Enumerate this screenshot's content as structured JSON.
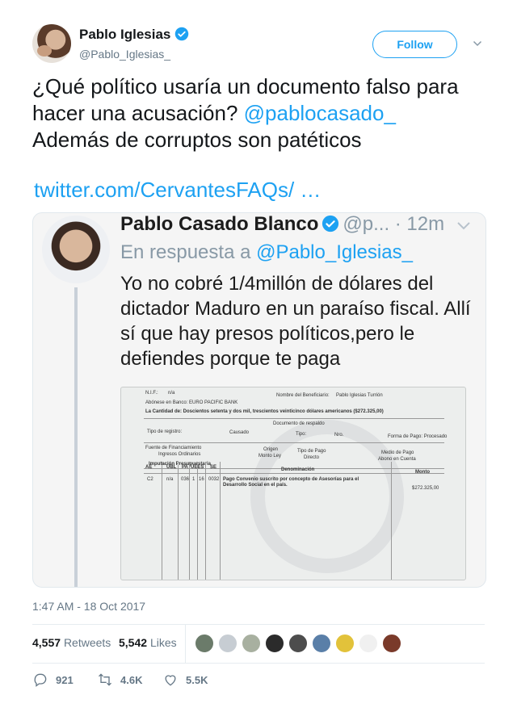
{
  "author": {
    "name": "Pablo Iglesias",
    "handle": "@Pablo_Iglesias_",
    "follow_label": "Follow"
  },
  "tweet": {
    "text_part1": "¿Qué político usaría un documento falso para hacer una acusación? ",
    "mention": "@pablocasado_",
    "text_part2": "Además de corruptos son patéticos",
    "link": "twitter.com/CervantesFAQs/ …"
  },
  "embedded_screenshot": {
    "name": "Pablo Casado Blanco",
    "meta": "@p... · 12m",
    "reply_prefix": "En respuesta a ",
    "reply_mention": "@Pablo_Iglesias_",
    "text": "Yo no cobré 1/4millón de dólares del dictador Maduro en un paraíso fiscal. Allí sí que hay presos políticos,pero le defiendes porque te paga",
    "document": {
      "nif": "N.I.F.:",
      "nif_val": "n/a",
      "beneficiario_label": "Nombre del Beneficiario:",
      "beneficiario": "Pablo Iglesias Turrión",
      "abonese": "Abónese en Banco: EURO PACIFIC BANK",
      "cantidad": "La Cantidad de: Doscientos setenta y dos mil, trescientos veinticinco dólares americanos ($272.325,00)",
      "doc_respaldo": "Documento de respaldo",
      "tipo_registro": "Tipo de registro:",
      "causado": "Causado",
      "tipo": "Tipo:",
      "nro": "Nro.",
      "forma_pago": "Forma de Pago: Procesado",
      "fuente": "Fuente de Financiamiento",
      "ingresos": "Ingresos Ordinarios",
      "origen": "Origen",
      "monto_ley": "Monto Ley",
      "tipo_pago": "Tipo de Pago",
      "directo": "Directo",
      "medio_pago": "Medio de Pago",
      "abono": "Abono en Cuenta",
      "imputacion": "Imputación Presupuestaria",
      "cols": [
        "AE",
        "UBL",
        "PA",
        "UEES",
        "SE",
        "Denominación",
        "Monto"
      ],
      "row": [
        "C2",
        "n/a",
        "036",
        "1",
        "16",
        "0032"
      ],
      "denominacion": "Pago Convenio suscrito por concepto de Asesorías para el Desarrollo Social en el país.",
      "monto": "$272.325,00"
    }
  },
  "timestamp": "1:47 AM - 18 Oct 2017",
  "stats": {
    "retweets_count": "4,557",
    "retweets_label": "Retweets",
    "likes_count": "5,542",
    "likes_label": "Likes"
  },
  "liker_colors": [
    "#6b7b6a",
    "#c7cdd3",
    "#a8b0a0",
    "#2b2b2b",
    "#4d4d4d",
    "#5a7fa8",
    "#e2c23a",
    "#f0f0f0",
    "#7a3a2a"
  ],
  "actions": {
    "reply_count": "921",
    "retweet_count": "4.6K",
    "like_count": "5.5K"
  },
  "colors": {
    "accent": "#1da1f2",
    "secondary_text": "#657786"
  }
}
